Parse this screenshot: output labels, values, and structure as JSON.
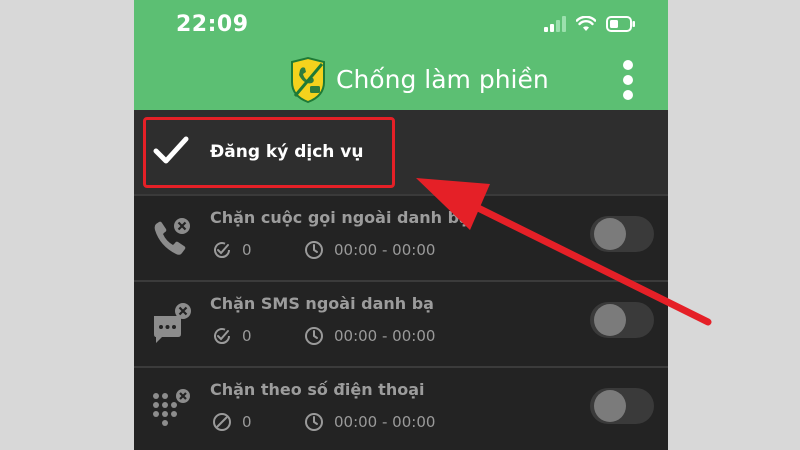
{
  "status_bar": {
    "time": "22:09",
    "icons": [
      "signal-icon",
      "wifi-icon",
      "battery-icon"
    ]
  },
  "app_bar": {
    "title": "Chống làm phiền",
    "logo_icon": "shield-block-icon",
    "menu_icon": "more-vertical-icon"
  },
  "register": {
    "label": "Đăng ký dịch vụ",
    "icon": "check-icon",
    "checked": true
  },
  "features": [
    {
      "title": "Chặn cuộc gọi ngoài danh bạ",
      "icon": "phone-blocked-icon",
      "count_icon": "check-circle-icon",
      "count": "0",
      "time_range": "00:00 - 00:00",
      "enabled": false
    },
    {
      "title": "Chặn SMS ngoài danh bạ",
      "icon": "sms-blocked-icon",
      "count_icon": "check-circle-icon",
      "count": "0",
      "time_range": "00:00 - 00:00",
      "enabled": false
    },
    {
      "title": "Chặn theo số điện thoại",
      "icon": "dialpad-blocked-icon",
      "count_icon": "ban-icon",
      "count": "0",
      "time_range": "00:00 - 00:00",
      "enabled": false
    }
  ],
  "colors": {
    "app_bar": "#5cbf73",
    "highlight": "#e52027",
    "background": "#232323"
  }
}
